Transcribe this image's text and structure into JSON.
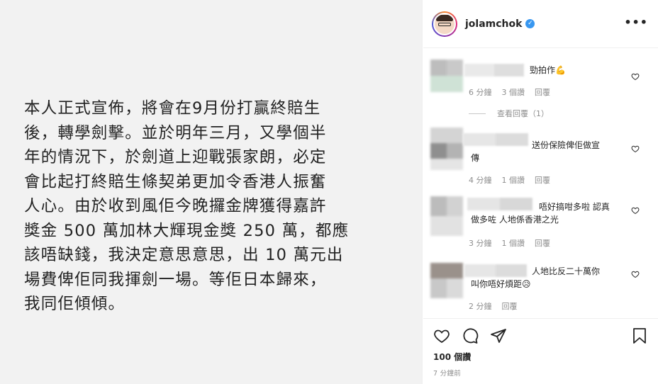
{
  "post": {
    "text": "本人正式宣佈，將會在9月份打贏終賠生\n後，轉學劍擊。並於明年三月，又學個半\n年的情況下，於劍道上迎戰張家朗，必定\n會比起打終賠生條契弟更加令香港人振奮\n人心。由於收到風佢今晚攞金牌獲得嘉許\n獎金 500 萬加林大輝現金獎 250 萬，都應\n該唔缺錢，我決定意思意思，出 10 萬元出\n場費俾佢同我揮劍一場。等佢日本歸來，\n我同佢傾傾。"
  },
  "header": {
    "username": "jolamchok",
    "verified_glyph": "✓",
    "more_glyph": "•••"
  },
  "comments": [
    {
      "text": "勁拍作💪",
      "time": "6 分鐘",
      "likes": "3 個讚",
      "reply": "回覆",
      "view_replies": "查看回覆（1）"
    },
    {
      "text": "送份保險俾佢做宣\n傳",
      "time": "4 分鐘",
      "likes": "1 個讚",
      "reply": "回覆"
    },
    {
      "text": "唔好搞咁多啦 認真\n做多咗 人地係香港之光",
      "time": "3 分鐘",
      "likes": "1 個讚",
      "reply": "回覆"
    },
    {
      "text": "人地比反二十萬你\n叫你唔好煩距😥",
      "time": "2 分鐘",
      "reply": "回覆"
    }
  ],
  "footer": {
    "likes": "100 個讚",
    "time": "7 分鐘前"
  },
  "icons": {
    "heart": "heart-icon",
    "comment": "comment-icon",
    "share": "share-icon",
    "save": "bookmark-icon"
  }
}
